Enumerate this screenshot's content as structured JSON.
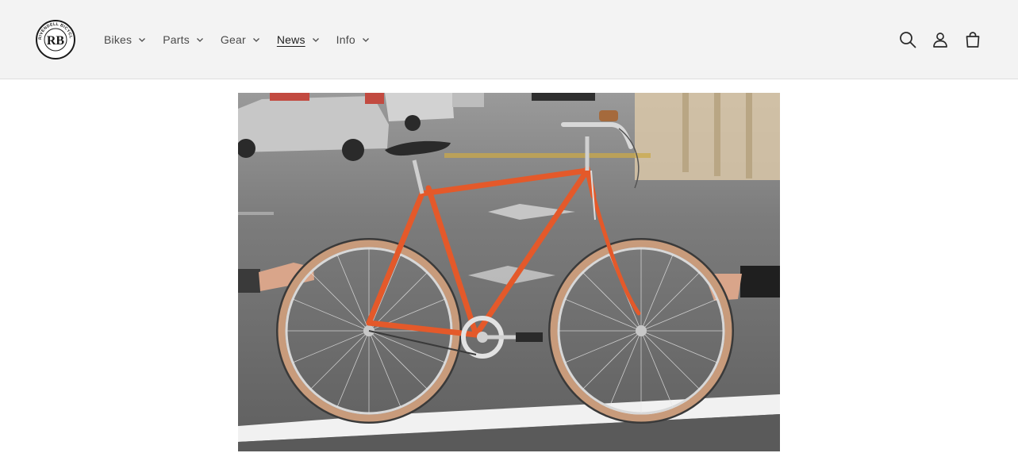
{
  "header": {
    "logo": {
      "icon": "rivendell-bicycle-works-logo",
      "text": "RIVENDELL BICYCLE WORKS · CCM MCMXCIV",
      "monogram": "RB"
    },
    "nav": [
      {
        "label": "Bikes",
        "active": false
      },
      {
        "label": "Parts",
        "active": false
      },
      {
        "label": "Gear",
        "active": false
      },
      {
        "label": "News",
        "active": true
      },
      {
        "label": "Info",
        "active": false
      }
    ],
    "icons": [
      "search-icon",
      "account-icon",
      "cart-icon"
    ]
  },
  "hero": {
    "image": "photo-orange-bicycle-held-by-two-hands",
    "colors": {
      "frame": "#e4592a",
      "tire": "#c89b7b",
      "asphalt": "#6e6e6e"
    }
  }
}
